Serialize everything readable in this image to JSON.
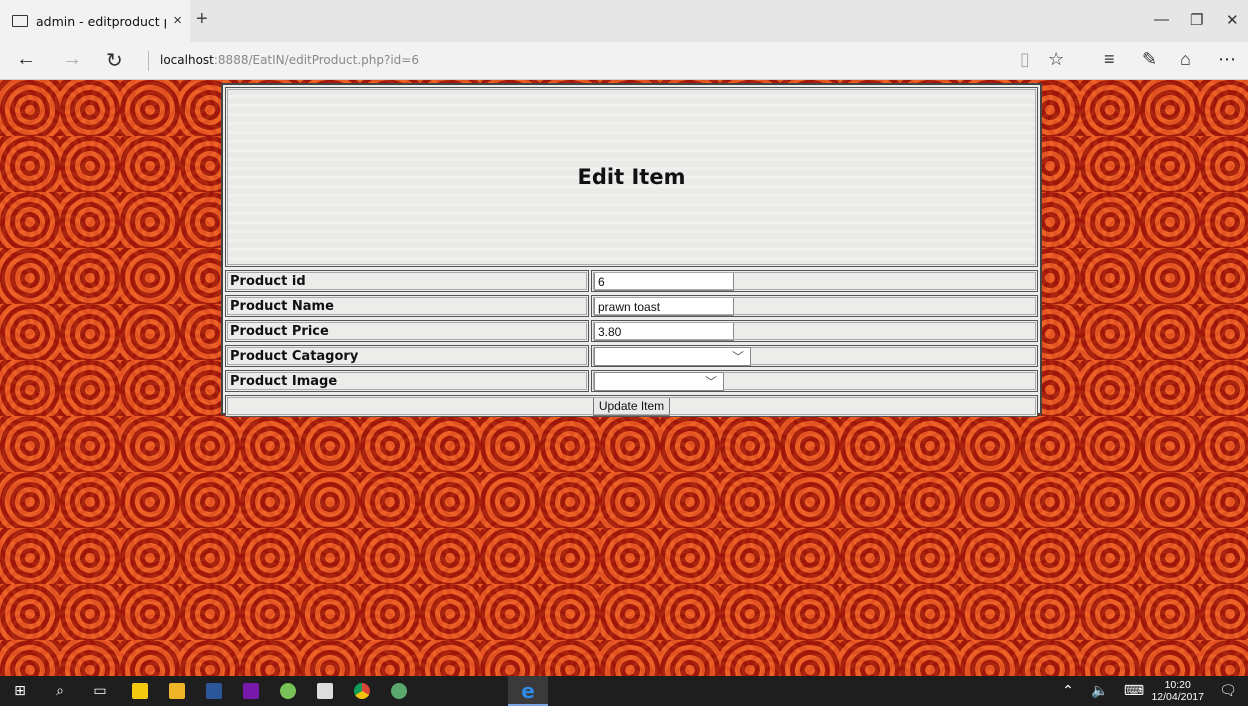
{
  "browser": {
    "tab_title": "admin - editproduct pa",
    "tab_close": "×",
    "new_tab": "+",
    "url_host": "localhost",
    "url_rest": ":8888/EatIN/editProduct.php?id=6",
    "window_minimize": "—",
    "window_restore": "❐",
    "window_close": "✕"
  },
  "form": {
    "title": "Edit Item",
    "rows": [
      {
        "label": "Product id",
        "value": "6",
        "type": "text"
      },
      {
        "label": "Product Name",
        "value": "prawn toast",
        "type": "text"
      },
      {
        "label": "Product Price",
        "value": "3.80",
        "type": "text"
      },
      {
        "label": "Product Catagory",
        "value": "",
        "type": "select"
      },
      {
        "label": "Product Image",
        "value": "",
        "type": "select"
      }
    ],
    "submit_label": "Update Item"
  },
  "taskbar": {
    "time": "10:20",
    "date": "12/04/2017"
  },
  "colors": {
    "background": "#d0320f",
    "panel": "#ececea",
    "taskbar": "#1e1e1e"
  }
}
